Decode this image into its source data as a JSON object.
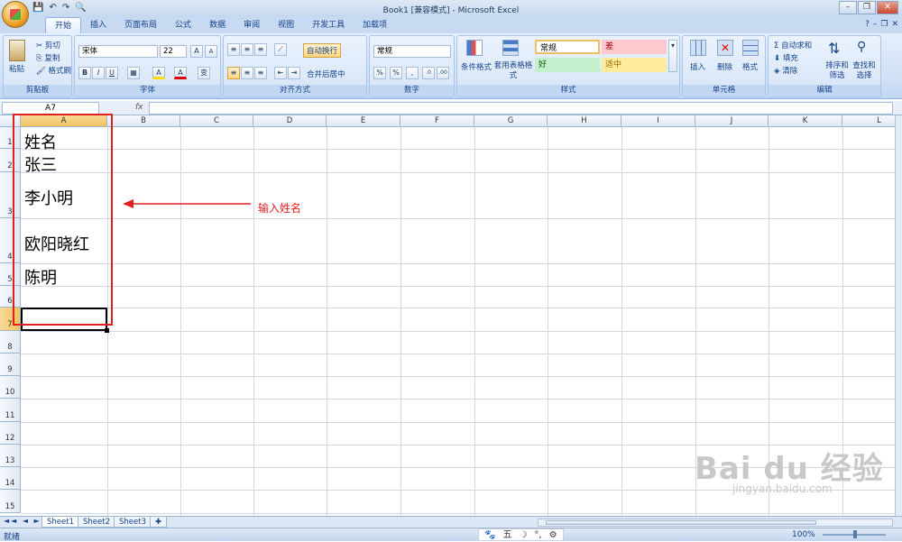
{
  "window": {
    "title": "Book1  [兼容模式] - Microsoft Excel"
  },
  "qat": {
    "save": "💾",
    "undo": "↶",
    "redo": "↷",
    "preview": "🔍"
  },
  "window_buttons": {
    "minimize": "–",
    "restore": "❐",
    "close": "✕"
  },
  "tabs": [
    "开始",
    "插入",
    "页面布局",
    "公式",
    "数据",
    "审阅",
    "视图",
    "开发工具",
    "加载项"
  ],
  "tabs_right": {
    "help": "?",
    "min": "–",
    "restore": "❐",
    "close": "✕"
  },
  "ribbon": {
    "clipboard": {
      "paste": "粘贴",
      "cut": "剪切",
      "copy": "复制",
      "format_painter": "格式刷",
      "label": "剪贴板"
    },
    "font": {
      "name": "宋体",
      "size": "22",
      "grow": "A",
      "shrink": "A",
      "bold": "B",
      "italic": "I",
      "underline": "U",
      "border": "▦",
      "fill": "A",
      "color": "A",
      "wen": "变",
      "label": "字体"
    },
    "alignment": {
      "wrap": "自动换行",
      "merge": "合并后居中",
      "label": "对齐方式"
    },
    "number": {
      "format": "常规",
      "currency": "%",
      "percent": "%",
      "comma": ",",
      "inc": ".0",
      "dec": ".00",
      "label": "数字"
    },
    "styles": {
      "conditional": "条件格式",
      "table": "套用表格格式",
      "normal": "常规",
      "bad": "差",
      "good": "好",
      "neutral": "适中",
      "label": "样式"
    },
    "cells": {
      "insert": "插入",
      "delete": "删除",
      "format": "格式",
      "label": "单元格"
    },
    "editing": {
      "autosum": "自动求和",
      "fill": "填充",
      "clear": "清除",
      "sort": "排序和筛选",
      "find": "查找和选择",
      "label": "编辑"
    }
  },
  "formula_bar": {
    "name_box": "A7",
    "fx": "fx",
    "content": ""
  },
  "columns": [
    "A",
    "B",
    "C",
    "D",
    "E",
    "F",
    "G",
    "H",
    "I",
    "J",
    "K",
    "L"
  ],
  "rows": [
    "1",
    "2",
    "3",
    "4",
    "5",
    "6",
    "7",
    "8",
    "9",
    "10",
    "11",
    "12",
    "13",
    "14",
    "15"
  ],
  "cells": {
    "A1": "姓名",
    "A2": "张三",
    "A3": "李小明",
    "A4": "欧阳晓红",
    "A5": "陈明"
  },
  "annotation": "输入姓名",
  "sheets": [
    "Sheet1",
    "Sheet2",
    "Sheet3"
  ],
  "sheet_nav": "◄◄ ◄ ► ►►",
  "status": {
    "ready": "就绪",
    "zoom": "100%"
  },
  "ime": [
    "🐾",
    "五",
    "☽",
    "°,",
    "⚙"
  ],
  "watermark": {
    "logo": "Bai du 经验",
    "url": "jingyan.baidu.com"
  }
}
